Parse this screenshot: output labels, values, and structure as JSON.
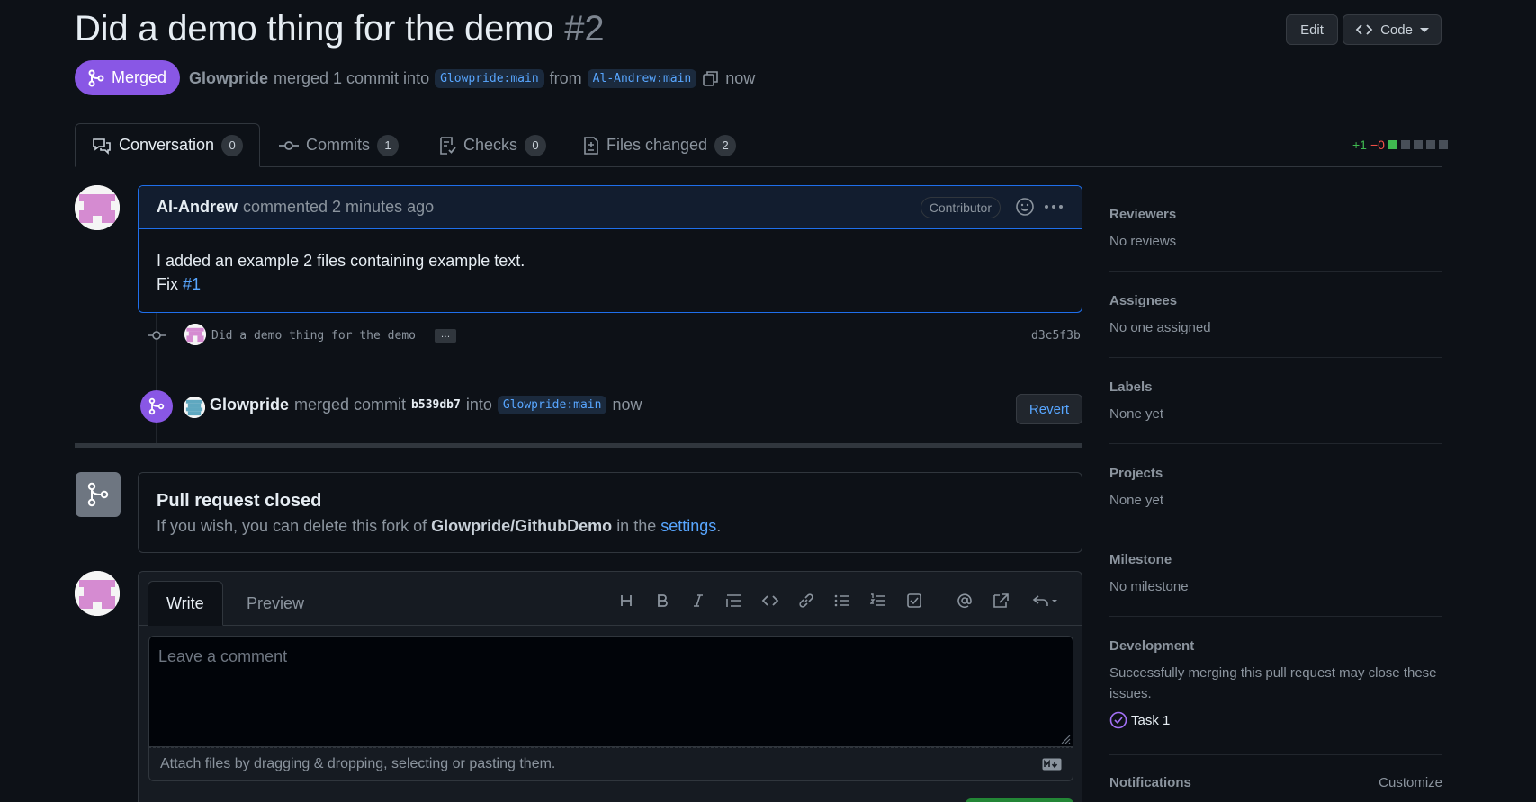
{
  "pr": {
    "title": "Did a demo thing for the demo",
    "number": "#2",
    "edit_label": "Edit",
    "code_label": "Code",
    "status": "Merged",
    "merger": "Glowpride",
    "merged_text": "merged 1 commit into",
    "base_branch": "Glowpride:main",
    "from_text": "from",
    "head_branch": "Al-Andrew:main",
    "time": "now"
  },
  "tabs": [
    {
      "label": "Conversation",
      "count": "0"
    },
    {
      "label": "Commits",
      "count": "1"
    },
    {
      "label": "Checks",
      "count": "0"
    },
    {
      "label": "Files changed",
      "count": "2"
    }
  ],
  "diffstat": {
    "additions": "+1",
    "deletions": "−0"
  },
  "comment": {
    "author": "Al-Andrew",
    "action": "commented 2 minutes ago",
    "badge": "Contributor",
    "body_line1": "I added an example 2 files containing example text.",
    "fix_prefix": "Fix",
    "fix_link": "#1"
  },
  "commit": {
    "message": "Did a demo thing for the demo",
    "ellipsis": "…",
    "sha": "d3c5f3b"
  },
  "merge_event": {
    "actor": "Glowpride",
    "text": "merged commit",
    "sha": "b539db7",
    "into": "into",
    "branch": "Glowpride:main",
    "time": "now",
    "revert_label": "Revert"
  },
  "closed": {
    "heading": "Pull request closed",
    "text_prefix": "If you wish, you can delete this fork of",
    "repo": "Glowpride/GithubDemo",
    "text_mid": "in the",
    "link": "settings",
    "text_end": "."
  },
  "editor": {
    "write_tab": "Write",
    "preview_tab": "Preview",
    "placeholder": "Leave a comment",
    "attach_text": "Attach files by dragging & dropping, selecting or pasting them.",
    "toolbar_icons": [
      "heading-icon",
      "bold-icon",
      "italic-icon",
      "quote-icon",
      "code-icon",
      "link-icon",
      "unordered-list-icon",
      "ordered-list-icon",
      "task-list-icon",
      "mention-icon",
      "reference-icon",
      "saved-replies-icon"
    ]
  },
  "sidebar": {
    "reviewers": {
      "label": "Reviewers",
      "value": "No reviews"
    },
    "assignees": {
      "label": "Assignees",
      "value": "No one assigned"
    },
    "labels": {
      "label": "Labels",
      "value": "None yet"
    },
    "projects": {
      "label": "Projects",
      "value": "None yet"
    },
    "milestone": {
      "label": "Milestone",
      "value": "No milestone"
    },
    "development": {
      "label": "Development",
      "value": "Successfully merging this pull request may close these issues.",
      "issue": "Task 1"
    },
    "notifications": {
      "label": "Notifications",
      "customize": "Customize"
    }
  },
  "colors": {
    "merged": "#8957e5",
    "link": "#58a6ff",
    "background": "#0d1117",
    "additions": "#3fb950",
    "deletions": "#f85149"
  }
}
